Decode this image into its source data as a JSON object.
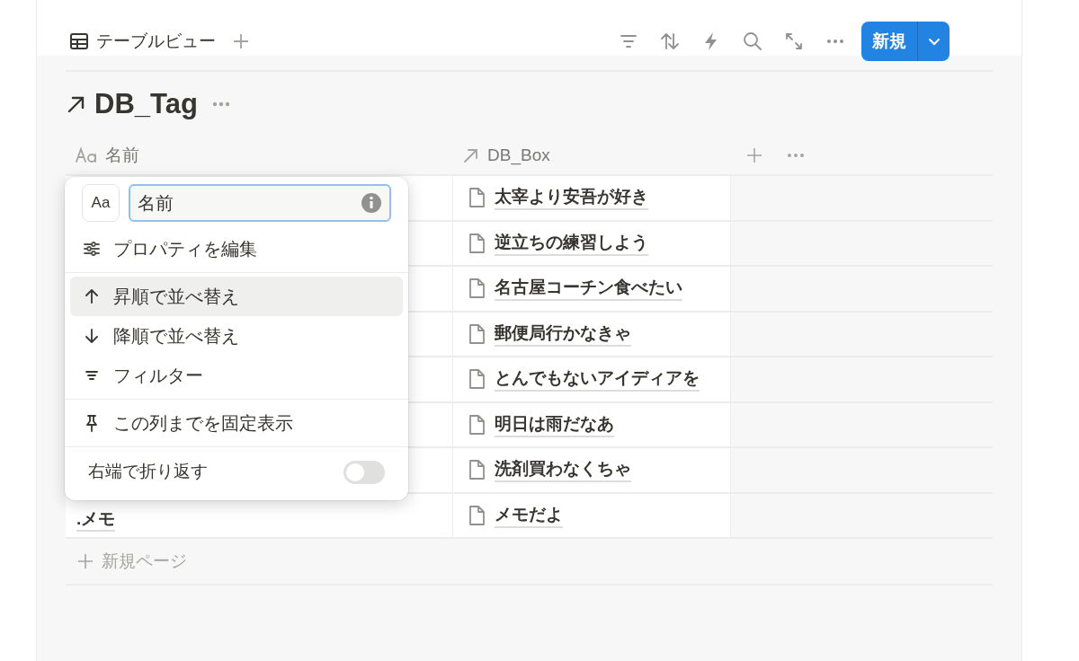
{
  "toolbar": {
    "view_tab": "テーブルビュー",
    "new_button": "新規"
  },
  "database": {
    "title": "DB_Tag"
  },
  "table": {
    "columns": [
      {
        "kind": "title",
        "label": "名前"
      },
      {
        "kind": "relation",
        "label": "DB_Box"
      }
    ],
    "rows": [
      {
        "db_box": "太宰より安吾が好き"
      },
      {
        "db_box": "逆立ちの練習しよう"
      },
      {
        "db_box": "名古屋コーチン食べたい"
      },
      {
        "db_box": "郵便局行かなきゃ"
      },
      {
        "db_box": "とんでもないアイディアを"
      },
      {
        "db_box": "明日は雨だなあ"
      },
      {
        "db_box": "洗剤買わなくちゃ"
      },
      {
        "name": ".メモ",
        "db_box": "メモだよ"
      }
    ],
    "new_page": "新規ページ"
  },
  "column_menu": {
    "type_icon": "Aa",
    "name_field": "名前",
    "groups": [
      [
        {
          "kind": "sliders",
          "label": "プロパティを編集",
          "highlighted": false
        }
      ],
      [
        {
          "kind": "arrow-up",
          "label": "昇順で並べ替え",
          "highlighted": true
        },
        {
          "kind": "arrow-down",
          "label": "降順で並べ替え",
          "highlighted": false
        },
        {
          "kind": "filter",
          "label": "フィルター",
          "highlighted": false
        }
      ],
      [
        {
          "kind": "pin",
          "label": "この列までを固定表示",
          "highlighted": false
        }
      ]
    ],
    "wrap_toggle": {
      "label": "右端で折り返す",
      "on": false
    }
  }
}
